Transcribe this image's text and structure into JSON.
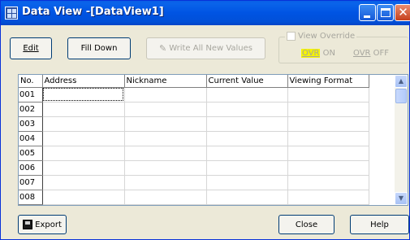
{
  "window": {
    "title": "Data View -[DataView1]",
    "close_glyph": "✕"
  },
  "toolbar": {
    "edit_label": "Edit",
    "fill_down_label": "Fill Down",
    "write_all_label": "Write All New Values"
  },
  "override": {
    "legend": "View Override",
    "ovr_on_hot": "OVR",
    "ovr_on_text": " ON",
    "ovr_off_hot": "OVR",
    "ovr_off_text": " OFF"
  },
  "table": {
    "columns": [
      "No.",
      "Address",
      "Nickname",
      "Current Value",
      "Viewing Format"
    ],
    "rows": [
      {
        "no": "001",
        "address": "",
        "nickname": "",
        "current_value": "",
        "viewing_format": ""
      },
      {
        "no": "002",
        "address": "",
        "nickname": "",
        "current_value": "",
        "viewing_format": ""
      },
      {
        "no": "003",
        "address": "",
        "nickname": "",
        "current_value": "",
        "viewing_format": ""
      },
      {
        "no": "004",
        "address": "",
        "nickname": "",
        "current_value": "",
        "viewing_format": ""
      },
      {
        "no": "005",
        "address": "",
        "nickname": "",
        "current_value": "",
        "viewing_format": ""
      },
      {
        "no": "006",
        "address": "",
        "nickname": "",
        "current_value": "",
        "viewing_format": ""
      },
      {
        "no": "007",
        "address": "",
        "nickname": "",
        "current_value": "",
        "viewing_format": ""
      },
      {
        "no": "008",
        "address": "",
        "nickname": "",
        "current_value": "",
        "viewing_format": ""
      }
    ]
  },
  "footer": {
    "export_label": "Export",
    "close_label": "Close",
    "help_label": "Help"
  },
  "icons": {
    "app": "dataview-app-icon",
    "write": "pencil-icon",
    "export": "floppy-disk-icon"
  },
  "colors": {
    "titlebar": "#0054e3",
    "close_button": "#c5401d",
    "ovr_highlight": "#f6f400",
    "disabled_text": "#a7a69e"
  }
}
